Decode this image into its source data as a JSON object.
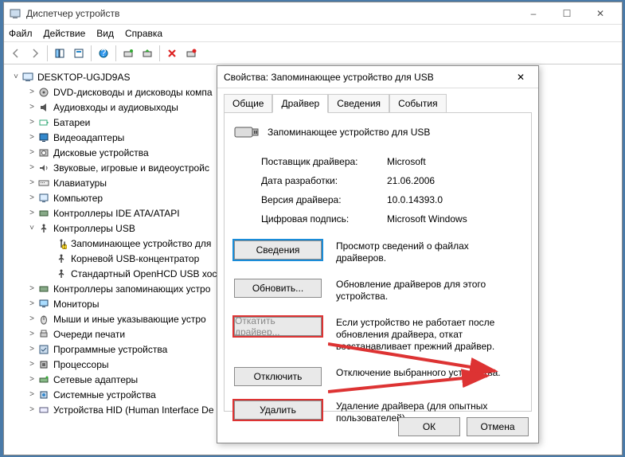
{
  "window": {
    "title": "Диспетчер устройств"
  },
  "menu": {
    "file": "Файл",
    "action": "Действие",
    "view": "Вид",
    "help": "Справка"
  },
  "tree": {
    "root": "DESKTOP-UGJD9AS",
    "items": [
      "DVD-дисководы и дисководы компа",
      "Аудиовходы и аудиовыходы",
      "Батареи",
      "Видеоадаптеры",
      "Дисковые устройства",
      "Звуковые, игровые и видеоустройс",
      "Клавиатуры",
      "Компьютер",
      "Контроллеры IDE ATA/ATAPI"
    ],
    "usb_group": "Контроллеры USB",
    "usb_children": [
      "Запоминающее устройство для",
      "Корневой USB-концентратор",
      "Стандартный OpenHCD USB хост"
    ],
    "items2": [
      "Контроллеры запоминающих устро",
      "Мониторы",
      "Мыши и иные указывающие устро",
      "Очереди печати",
      "Программные устройства",
      "Процессоры",
      "Сетевые адаптеры",
      "Системные устройства",
      "Устройства HID (Human Interface De"
    ]
  },
  "dialog": {
    "title": "Свойства: Запоминающее устройство для USB",
    "tabs": {
      "general": "Общие",
      "driver": "Драйвер",
      "details": "Сведения",
      "events": "События"
    },
    "device_name": "Запоминающее устройство для USB",
    "fields": {
      "vendor_label": "Поставщик драйвера:",
      "vendor_value": "Microsoft",
      "date_label": "Дата разработки:",
      "date_value": "21.06.2006",
      "version_label": "Версия драйвера:",
      "version_value": "10.0.14393.0",
      "sig_label": "Цифровая подпись:",
      "sig_value": "Microsoft Windows"
    },
    "buttons": {
      "details": "Сведения",
      "details_desc": "Просмотр сведений о файлах драйверов.",
      "update": "Обновить...",
      "update_desc": "Обновление драйверов для этого устройства.",
      "rollback": "Откатить драйвер...",
      "rollback_desc": "Если устройство не работает после обновления драйвера, откат восстанавливает прежний драйвер.",
      "disable": "Отключить",
      "disable_desc": "Отключение выбранного устройства.",
      "uninstall": "Удалить",
      "uninstall_desc": "Удаление драйвера (для опытных пользователей)."
    },
    "ok": "ОК",
    "cancel": "Отмена"
  }
}
